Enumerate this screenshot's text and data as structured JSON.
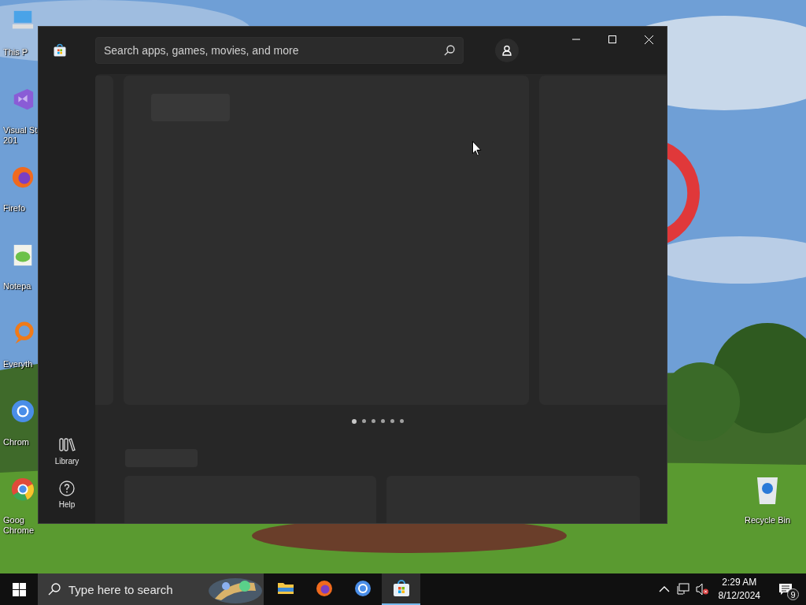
{
  "desktop_icons": [
    {
      "kind": "pc",
      "lines": [
        "This P"
      ]
    },
    {
      "kind": "vs",
      "lines": [
        "Visual St",
        "201"
      ]
    },
    {
      "kind": "firefox",
      "lines": [
        "Firefo"
      ]
    },
    {
      "kind": "notepad",
      "lines": [
        "Notepa"
      ]
    },
    {
      "kind": "everything",
      "lines": [
        "Everyth"
      ]
    },
    {
      "kind": "chromium",
      "lines": [
        "Chrom"
      ]
    },
    {
      "kind": "chrome",
      "lines": [
        "Goog",
        "Chrome"
      ]
    }
  ],
  "recycle_bin": {
    "label": "Recycle Bin"
  },
  "store_window": {
    "search": {
      "placeholder": "Search apps, games, movies, and more"
    },
    "sidebar": [
      {
        "kind": "library",
        "label": "Library"
      },
      {
        "kind": "help",
        "label": "Help"
      }
    ],
    "carousel_dots": [
      {
        "selected": true
      },
      {
        "selected": false
      },
      {
        "selected": false
      },
      {
        "selected": false
      },
      {
        "selected": false
      },
      {
        "selected": false
      }
    ]
  },
  "taskbar": {
    "search": {
      "placeholder": "Type here to search"
    },
    "apps": [
      {
        "kind": "explorer",
        "selected": false
      },
      {
        "kind": "firefox",
        "selected": false
      },
      {
        "kind": "chromium",
        "selected": false
      },
      {
        "kind": "store",
        "selected": true
      }
    ],
    "clock": {
      "time": "2:29 AM",
      "date": "8/12/2024"
    },
    "notifications": {
      "count": "9"
    }
  }
}
